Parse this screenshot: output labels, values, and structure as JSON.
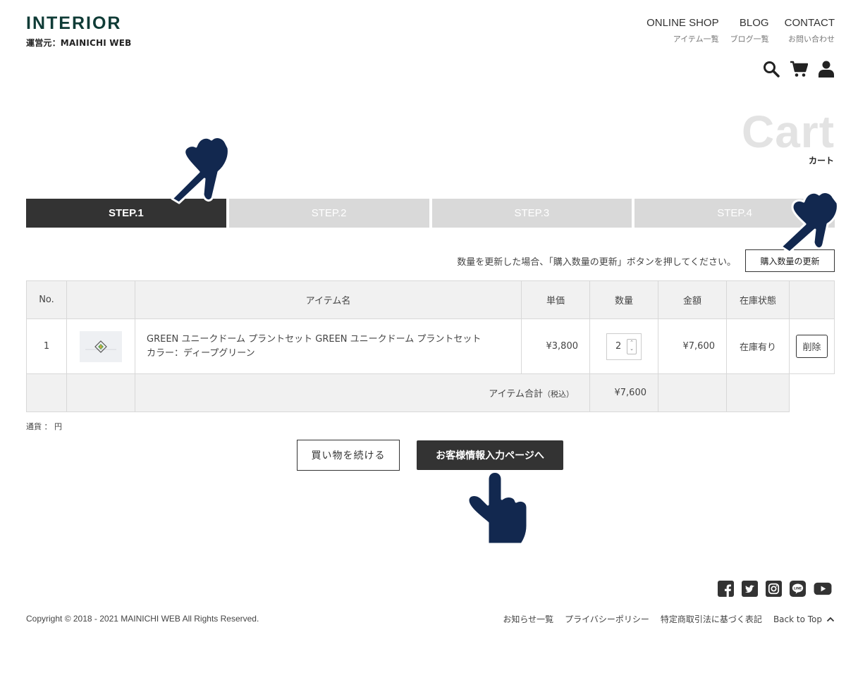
{
  "header": {
    "logo_title": "INTERIOR",
    "logo_sub": "運営元：MAINICHI WEB",
    "nav": [
      {
        "label": "ONLINE SHOP",
        "sub": "アイテム一覧"
      },
      {
        "label": "BLOG",
        "sub": "ブログ一覧"
      },
      {
        "label": "CONTACT",
        "sub": "お問い合わせ"
      }
    ],
    "icons": [
      "search-icon",
      "cart-icon",
      "user-icon"
    ]
  },
  "page": {
    "title_en": "Cart",
    "title_ja": "カート"
  },
  "steps": [
    {
      "label": "STEP.1",
      "active": true
    },
    {
      "label": "STEP.2",
      "active": false
    },
    {
      "label": "STEP.3",
      "active": false
    },
    {
      "label": "STEP.4",
      "active": false
    }
  ],
  "notice": "数量を更新した場合、「購入数量の更新」ボタンを押してください。",
  "update_button": "購入数量の更新",
  "table": {
    "headers": {
      "no": "No.",
      "image": "",
      "name": "アイテム名",
      "unit_price": "単価",
      "quantity": "数量",
      "amount": "金額",
      "stock": "在庫状態",
      "action": ""
    },
    "rows": [
      {
        "no": "1",
        "name_line1": "GREEN ユニークドーム プラントセット GREEN ユニークドーム プラントセット",
        "name_line2": "カラー：ディープグリーン",
        "unit_price": "¥3,800",
        "quantity": "2",
        "amount": "¥7,600",
        "stock": "在庫有り",
        "delete_label": "削除"
      }
    ],
    "total_label": "アイテム合計",
    "total_tax": "（税込）",
    "total_amount": "¥7,600"
  },
  "currency": "通貨 ： 円",
  "buttons": {
    "continue": "買い物を続ける",
    "next": "お客様情報入力ページへ"
  },
  "footer": {
    "social": [
      "facebook-icon",
      "twitter-icon",
      "instagram-icon",
      "line-icon",
      "youtube-icon"
    ],
    "copyright": "Copyright © 2018 - 2021 MAINICHI WEB All Rights Reserved.",
    "links": [
      "お知らせ一覧",
      "プライバシーポリシー",
      "特定商取引法に基づく表記"
    ],
    "back_to_top": "Back to Top"
  },
  "colors": {
    "accent_dark": "#333333",
    "logo": "#0f3b36",
    "step_inactive": "#d9d9d9",
    "pointer_hand": "#12284f"
  }
}
